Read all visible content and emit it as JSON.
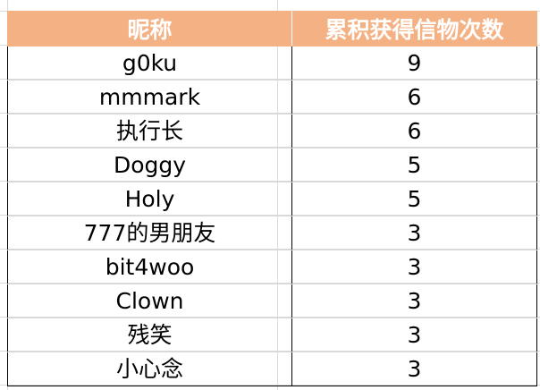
{
  "table": {
    "headers": {
      "nickname": "昵称",
      "count": "累积获得信物次数"
    },
    "header_color": "#f4b183",
    "rows": [
      {
        "nickname": "g0ku",
        "count": "9"
      },
      {
        "nickname": "mmmark",
        "count": "6"
      },
      {
        "nickname": "执行长",
        "count": "6"
      },
      {
        "nickname": "Doggy",
        "count": "5"
      },
      {
        "nickname": "Holy",
        "count": "5"
      },
      {
        "nickname": "777的男朋友",
        "count": "3"
      },
      {
        "nickname": "bit4woo",
        "count": "3"
      },
      {
        "nickname": "Clown",
        "count": "3"
      },
      {
        "nickname": "残笑",
        "count": "3"
      },
      {
        "nickname": "小心念",
        "count": "3"
      }
    ]
  }
}
